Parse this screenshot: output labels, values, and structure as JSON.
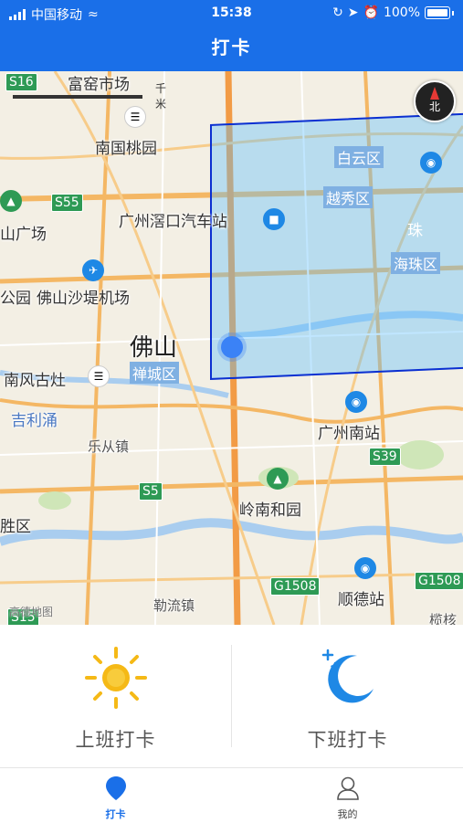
{
  "status_bar": {
    "carrier": "中国移动",
    "time": "15:38",
    "battery": "100%"
  },
  "nav": {
    "title": "打卡"
  },
  "map": {
    "scale_label": "0",
    "scale_unit": "千米",
    "watermark": "高德地图",
    "compass_label": "北",
    "labels": {
      "fushou_market": "富窑市场",
      "nanguo": "南国桃园",
      "guangchang": "山广场",
      "guangzhou_bus": "广州滘口汽车站",
      "baiyun": "白云区",
      "yuexiu": "越秀区",
      "zhujiang": "珠",
      "haizhu": "海珠区",
      "airport": "佛山沙堤机场",
      "gongyuan": "公园",
      "foshan": "佛山",
      "chancheng": "禅城区",
      "nanfeng": "南风古灶",
      "jilichong": "吉利涌",
      "lecong": "乐从镇",
      "gz_south": "广州南站",
      "lingnan": "岭南和园",
      "shengqu": "胜区",
      "leliu": "勒流镇",
      "shunde": "顺德站",
      "lianghe": "榄核"
    },
    "roads": {
      "s16": "S16",
      "s55": "S55",
      "s5": "S5",
      "s39": "S39",
      "g1508a": "G1508",
      "g1508b": "G1508",
      "s15": "S15"
    }
  },
  "punch": {
    "on_duty_label": "上班打卡",
    "off_duty_label": "下班打卡"
  },
  "tabs": [
    {
      "label": "打卡",
      "active": true
    },
    {
      "label": "我的",
      "active": false
    }
  ],
  "colors": {
    "primary": "#1a6fe8",
    "sun": "#f5b916",
    "moon": "#1e88e5",
    "fence": "#0b2fd1"
  }
}
